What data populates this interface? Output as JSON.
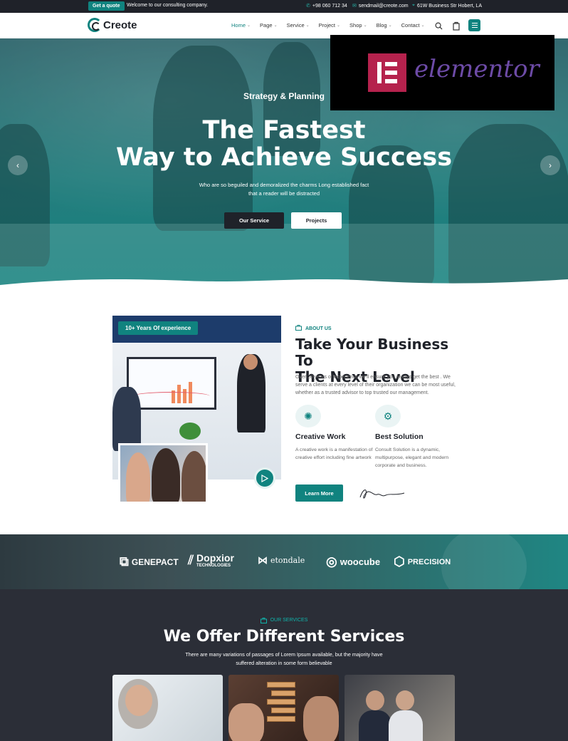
{
  "topbar": {
    "quote_label": "Get a quote",
    "welcome": "Welcome to our consulting company.",
    "phone": "+98 060 712 34",
    "email": "sendmail@creote.com",
    "address": "61W Business Str Hobert, LA"
  },
  "header": {
    "logo_text": "Creote",
    "nav": [
      {
        "label": "Home"
      },
      {
        "label": "Page"
      },
      {
        "label": "Service"
      },
      {
        "label": "Project"
      },
      {
        "label": "Shop"
      },
      {
        "label": "Blog"
      },
      {
        "label": "Contact"
      }
    ],
    "accent": "#10837f"
  },
  "hero": {
    "subtitle": "Strategy & Planning",
    "title_line1": "The Fastest",
    "title_line2": "Way to Achieve Success",
    "desc_line1": "Who are so beguiled and demoralized the charms Long established fact",
    "desc_line2": "that a reader will be distracted",
    "btn_primary": "Our Service",
    "btn_secondary": "Projects"
  },
  "badge": {
    "text": "elementor"
  },
  "about": {
    "experience": "10+ Years Of experience",
    "label": "ABOUT US",
    "title_line1": "Take Your Business To",
    "title_line2": "The Next Level",
    "desc": "Over 20 years of experience we'll ensure you always get the best . We serve a clients at every level of their organization we can be most useful, whether as a trusted advisor to top trusted our management.",
    "features": [
      {
        "title": "Creative Work",
        "desc": "A creative work is a manifestation of creative effort including fine artwork",
        "icon": "brain-icon"
      },
      {
        "title": "Best Solution",
        "desc": "Consult Solution is a dynamic, multipurpose, elegant and modern corporate and business.",
        "icon": "gear-head-icon"
      }
    ],
    "learn_more": "Learn More"
  },
  "brands": [
    {
      "name": "GENEPACT",
      "sub": ""
    },
    {
      "name": "Dopxior",
      "sub": "TECHNOLOGIES"
    },
    {
      "name": "etondale",
      "sub": ""
    },
    {
      "name": "woocube",
      "sub": ""
    },
    {
      "name": "PRECISION",
      "sub": ""
    }
  ],
  "services": {
    "label": "OUR SERVICES",
    "title": "We Offer Different Services",
    "desc_line1": "There are many variations of passages of Lorem Ipsum available, but the majority have",
    "desc_line2": "suffered alteration in some form believable"
  }
}
